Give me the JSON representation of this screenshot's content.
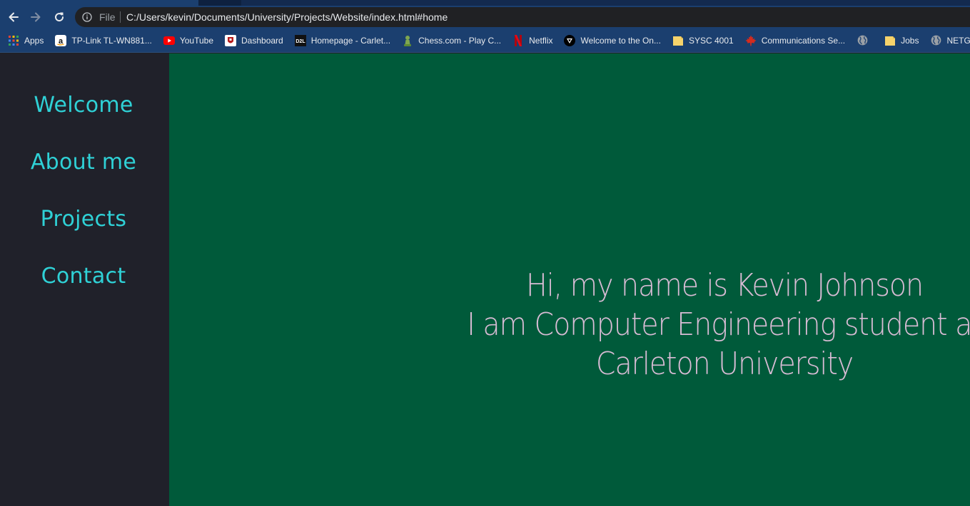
{
  "browser": {
    "scheme_label": "File",
    "url": "C:/Users/kevin/Documents/University/Projects/Website/index.html#home",
    "accent": "#1b3f6f"
  },
  "bookmarks": [
    {
      "label": "Apps",
      "icon": "apps-grid-icon"
    },
    {
      "label": "TP-Link TL-WN881...",
      "icon": "amazon-icon"
    },
    {
      "label": "YouTube",
      "icon": "youtube-icon"
    },
    {
      "label": "Dashboard",
      "icon": "dashboard-icon"
    },
    {
      "label": "Homepage - Carlet...",
      "icon": "d2l-icon"
    },
    {
      "label": "Chess.com - Play C...",
      "icon": "chess-pawn-icon"
    },
    {
      "label": "Netflix",
      "icon": "netflix-icon"
    },
    {
      "label": "Welcome to the On...",
      "icon": "shield-icon"
    },
    {
      "label": "SYSC 4001",
      "icon": "folder-icon"
    },
    {
      "label": "Communications Se...",
      "icon": "maple-leaf-icon"
    },
    {
      "label": "",
      "icon": "globe-icon"
    },
    {
      "label": "Jobs",
      "icon": "folder-icon"
    },
    {
      "label": "NETGEAR",
      "icon": "globe-icon"
    }
  ],
  "sidebar": {
    "links": [
      "Welcome",
      "About me",
      "Projects",
      "Contact"
    ],
    "background": "#20212a",
    "link_color": "#2fd1d6"
  },
  "hero": {
    "line1": "Hi, my name is Kevin Johnson",
    "line2": "I am Computer Engineering student at",
    "line3": "Carleton University",
    "background": "#005a3a",
    "text_color": "#d9bcd5"
  }
}
